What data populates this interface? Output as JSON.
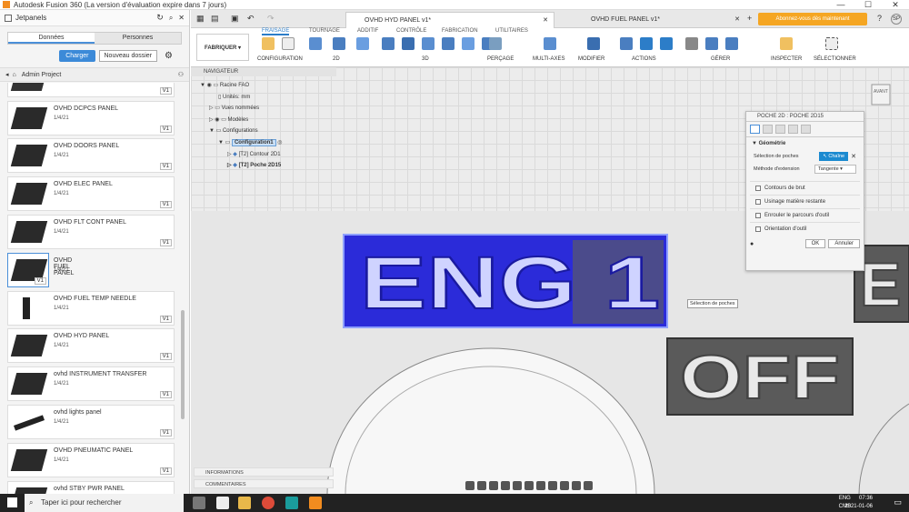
{
  "window": {
    "title": "Autodesk Fusion 360 (La version d'évaluation expire dans 7 jours)",
    "controls": [
      "—",
      "☐",
      "✕"
    ]
  },
  "left_panel": {
    "team": "Jetpanels",
    "tabs": [
      "Données",
      "Personnes"
    ],
    "upload_label": "Charger",
    "new_folder_label": "Nouveau dossier",
    "project": "Admin Project",
    "files": [
      {
        "name": "",
        "date": "",
        "version": "V1"
      },
      {
        "name": "OVHD DCPCS PANEL",
        "date": "1/4/21",
        "version": "V1"
      },
      {
        "name": "OVHD DOORS PANEL",
        "date": "1/4/21",
        "version": "V1"
      },
      {
        "name": "OVHD ELEC PANEL",
        "date": "1/4/21",
        "version": "V1"
      },
      {
        "name": "OVHD FLT CONT PANEL",
        "date": "1/4/21",
        "version": "V1"
      },
      {
        "name": "OVHD FUEL PANEL",
        "date": "1/4/21",
        "version": "V1"
      },
      {
        "name": "OVHD FUEL TEMP NEEDLE",
        "date": "1/4/21",
        "version": "V1"
      },
      {
        "name": "OVHD HYD PANEL",
        "date": "1/4/21",
        "version": "V1"
      },
      {
        "name": "ovhd INSTRUMENT TRANSFER",
        "date": "1/4/21",
        "version": "V1"
      },
      {
        "name": "ovhd lights panel",
        "date": "1/4/21",
        "version": "V1"
      },
      {
        "name": "OVHD PNEUMATIC PANEL",
        "date": "1/4/21",
        "version": "V1"
      },
      {
        "name": "ovhd STBY PWR PANEL",
        "date": "",
        "version": ""
      }
    ]
  },
  "doc_tabs": [
    {
      "label": "OVHD HYD PANEL v1*",
      "active": true
    },
    {
      "label": "OVHD FUEL PANEL v1*",
      "active": false
    }
  ],
  "trial_button": "Abonnez-vous dès maintenant",
  "user_initials": "SP",
  "workspace": "FABRIQUER",
  "toolbar_tabs": [
    "FRAISAGE",
    "TOURNAGE",
    "ADDITIF",
    "CONTRÔLE",
    "FABRICATION",
    "UTILITAIRES"
  ],
  "toolbar_groups": [
    "CONFIGURATION",
    "2D",
    "3D",
    "PERÇAGE",
    "MULTI-AXES",
    "MODIFIER",
    "ACTIONS",
    "GÉRER",
    "INSPECTER",
    "SÉLECTIONNER"
  ],
  "navigator": {
    "title": "NAVIGATEUR",
    "items": [
      {
        "label": "Racine FAO"
      },
      {
        "label": "Unités: mm"
      },
      {
        "label": "Vues nommées"
      },
      {
        "label": "Modèles"
      },
      {
        "label": "Configurations"
      },
      {
        "label": "Configuration1"
      },
      {
        "label": "[T2] Contour 2D1"
      },
      {
        "label": "[T2] Poche 2D15"
      }
    ]
  },
  "scene": {
    "label1": "ENG 1",
    "label2": "OFF",
    "highlight_color": "#2b2bd9"
  },
  "viewcube_label": "AVANT",
  "dialog": {
    "title": "POCHE 2D : POCHE 2D15",
    "section": "Géométrie",
    "pocket_sel_label": "Sélection de poches",
    "chain_label": "Chaîne",
    "extension_label": "Méthode d'extension",
    "extension_value": "Tangente",
    "options": [
      "Contours de brut",
      "Usinage matière restante",
      "Enrouler le parcours d'outil",
      "Orientation d'outil"
    ],
    "ok": "OK",
    "cancel": "Annuler"
  },
  "tooltip": "Sélection de poches",
  "bottom_panels": [
    "INFORMATIONS",
    "COMMENTAIRES"
  ],
  "taskbar": {
    "search": "Taper ici pour rechercher",
    "lang1": "ENG",
    "lang2": "CMS",
    "time": "07:36",
    "date": "2021-01-06"
  }
}
